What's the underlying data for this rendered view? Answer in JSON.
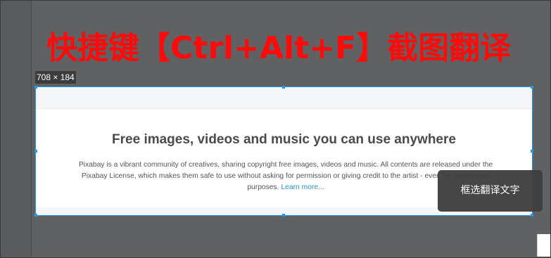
{
  "banner": {
    "text": "快捷键【Ctrl+Alt+F】截图翻译"
  },
  "selection": {
    "size_label": "708 × 184"
  },
  "captured_page": {
    "headline": "Free images, videos and music you can use anywhere",
    "description": "Pixabay is a vibrant community of creatives, sharing copyright free images, videos and music. All contents are released under the Pixabay License, which makes them safe to use without asking for permission or giving credit to the artist - even for commercial purposes.",
    "learn_more": "Learn more..."
  },
  "tooltip": {
    "text": "框选翻译文字"
  },
  "colors": {
    "accent": "#1e9af0",
    "banner_red": "#ff0a0a",
    "overlay": "#606162"
  }
}
